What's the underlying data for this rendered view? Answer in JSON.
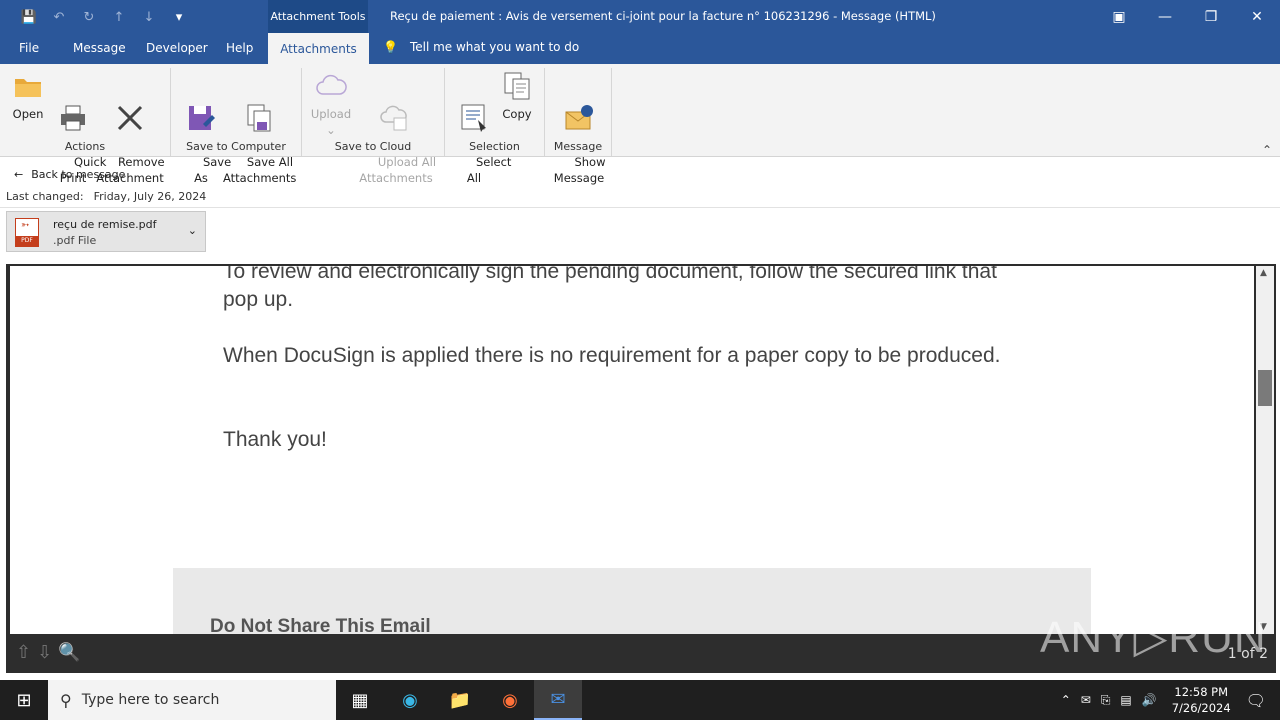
{
  "titlebar": {
    "context_tab": "Attachment Tools",
    "title": "Reçu de paiement : Avis de versement ci-joint pour la facture n° 106231296  -  Message (HTML)"
  },
  "menu": {
    "items": [
      "File",
      "Message",
      "Developer",
      "Help"
    ],
    "active": "Attachments",
    "tellme": "Tell me what you want to do"
  },
  "ribbon": {
    "actions": {
      "label": "Actions",
      "open": "Open",
      "quick_print": "Quick\nPrint",
      "remove": "Remove\nAttachment"
    },
    "save_computer": {
      "label": "Save to Computer",
      "save_as": "Save\nAs",
      "save_all": "Save All\nAttachments"
    },
    "save_cloud": {
      "label": "Save to Cloud",
      "upload": "Upload",
      "upload_all": "Upload All\nAttachments"
    },
    "selection": {
      "label": "Selection",
      "select_all": "Select\nAll",
      "copy": "Copy"
    },
    "message": {
      "label": "Message",
      "show_message": "Show\nMessage"
    }
  },
  "nav": {
    "back": "Back to message",
    "last_changed_label": "Last changed:",
    "last_changed_value": "Friday, July 26, 2024"
  },
  "attachment": {
    "name": "reçu de remise.pdf",
    "type": ".pdf File",
    "badge": "PDF"
  },
  "document": {
    "p1": "To review and electronically sign the pending document, follow the secured link that pop up.",
    "p2": "When DocuSign is applied there is no requirement for a paper copy to be produced.",
    "p3": "Thank you!",
    "footer_heading": "Do Not Share This Email"
  },
  "preview": {
    "page_indicator": "1 of 2"
  },
  "watermark": "ANY▷RUN",
  "taskbar": {
    "search_placeholder": "Type here to search",
    "time": "12:58 PM",
    "date": "7/26/2024"
  }
}
